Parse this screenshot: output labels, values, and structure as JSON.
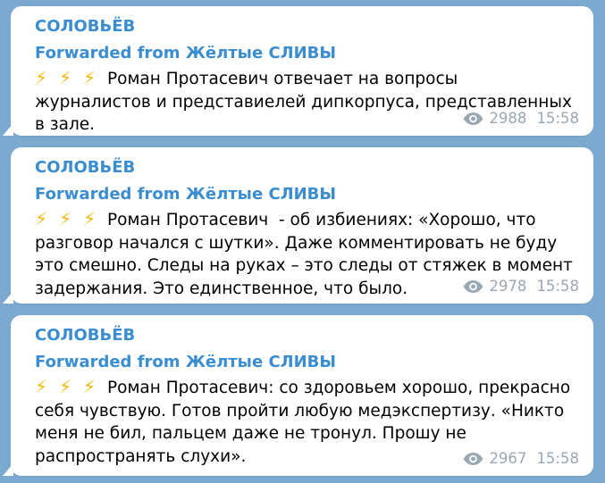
{
  "colors": {
    "background": "#7ba9cf",
    "bubble": "#ffffff",
    "accent": "#3a8dd0",
    "meta": "#9aa8b4",
    "bolt": "#f2b90c"
  },
  "messages": [
    {
      "channel": "СОЛОВЬЁВ",
      "forward_prefix": "Forwarded from",
      "forward_source": "Жёлтые СЛИВЫ",
      "bolt_icons": [
        "⚡",
        "⚡",
        "⚡"
      ],
      "text": "Роман Протасевич отвечает на вопросы журналистов и представиелей дипкорпуса, представленных в зале.",
      "views": "2988",
      "time": "15:58"
    },
    {
      "channel": "СОЛОВЬЁВ",
      "forward_prefix": "Forwarded from",
      "forward_source": "Жёлтые СЛИВЫ",
      "bolt_icons": [
        "⚡",
        "⚡",
        "⚡"
      ],
      "text": "Роман Протасевич  - об избиениях: «Хорошо, что разговор начался с шутки». Даже комментировать не буду это смешно. Следы на руках – это следы от стяжек в момент задержания. Это единственное, что было.",
      "views": "2978",
      "time": "15:58"
    },
    {
      "channel": "СОЛОВЬЁВ",
      "forward_prefix": "Forwarded from",
      "forward_source": "Жёлтые СЛИВЫ",
      "bolt_icons": [
        "⚡",
        "⚡",
        "⚡"
      ],
      "text": "Роман Протасевич: со здоровьем хорошо, прекрасно себя чувствую. Готов пройти любую медэкспертизу. «Никто меня не бил, пальцем даже не тронул. Прошу не распространять слухи».",
      "views": "2967",
      "time": "15:58"
    }
  ]
}
